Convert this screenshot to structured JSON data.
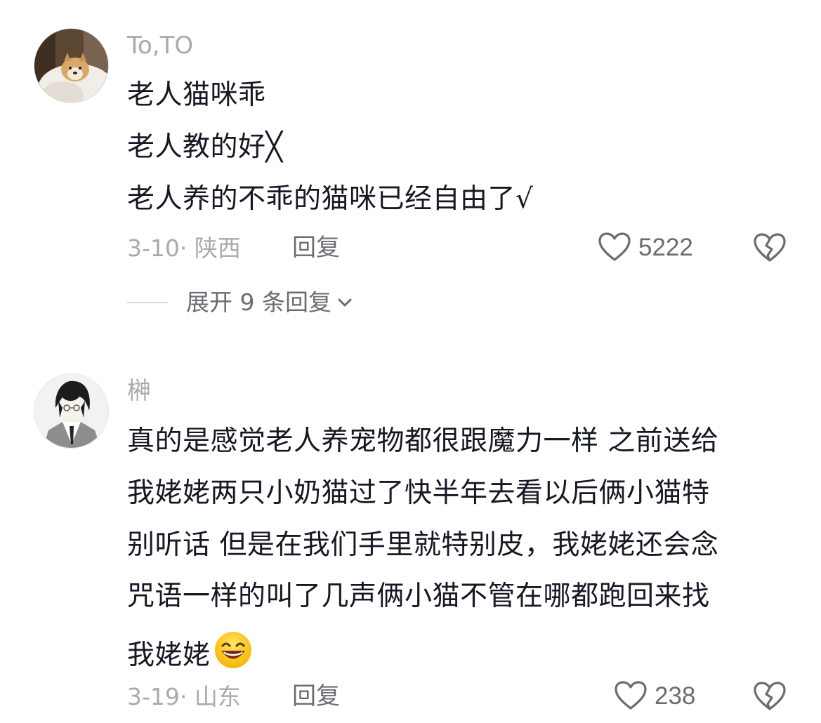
{
  "comments": [
    {
      "username": "To,TO",
      "lines": [
        "老人猫咪乖",
        "老人教的好╳",
        "老人养的不乖的猫咪已经自由了√"
      ],
      "date": "3-10",
      "location": "陕西",
      "reply_label": "回复",
      "likes": "5222",
      "expand_label": "展开 9 条回复"
    },
    {
      "username": "榊",
      "lines": [
        "真的是感觉老人养宠物都很跟魔力一样 之前送给",
        "我姥姥两只小奶猫过了快半年去看以后俩小猫特",
        "别听话 但是在我们手里就特别皮，我姥姥还会念",
        "咒语一样的叫了几声俩小猫不管在哪都跑回来找",
        "我姥姥"
      ],
      "emoji": "grinning-face-emoji",
      "date": "3-19",
      "location": "山东",
      "reply_label": "回复",
      "likes": "238"
    }
  ],
  "icons": {
    "like": "heart-outline-icon",
    "dislike": "broken-heart-icon",
    "expand": "chevron-down-icon"
  },
  "colors": {
    "text": "#161823",
    "muted": "#a9a9ae",
    "secondary": "#6b6c72"
  }
}
